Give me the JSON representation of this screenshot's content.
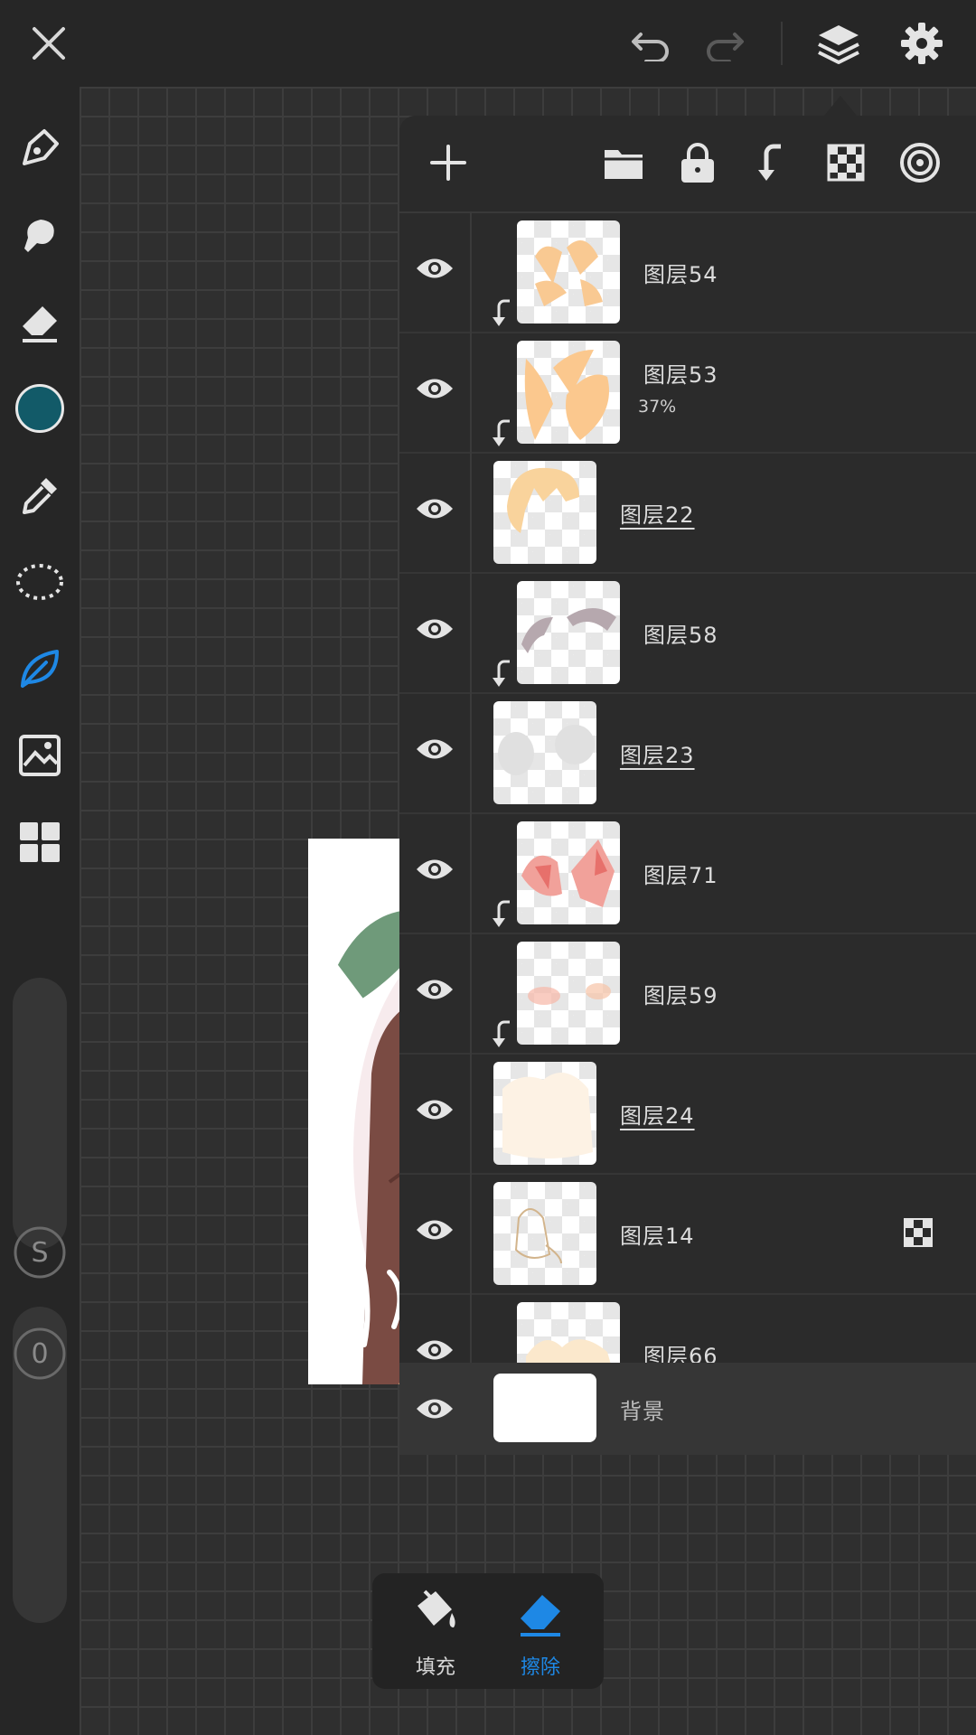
{
  "topbar": {
    "icons": [
      "close-icon",
      "undo-icon",
      "redo-icon",
      "layers-icon",
      "settings-icon"
    ]
  },
  "tools": {
    "icons": [
      "pen-icon",
      "smudge-icon",
      "eraser-icon",
      "color-swatch",
      "eyedropper-icon",
      "lasso-icon",
      "leaf-icon",
      "image-import-icon",
      "grid-icon"
    ],
    "active_color": "#125a68",
    "accent": "#1e88e5",
    "size_knob": "S",
    "opacity_knob": "0"
  },
  "layer_panel": {
    "toolbar_icons": [
      "add-layer-icon",
      "folder-icon",
      "lock-icon",
      "clip-icon",
      "alpha-lock-icon",
      "blend-icon"
    ],
    "layers": [
      {
        "name": "图层54",
        "opacity": "",
        "clipped": true
      },
      {
        "name": "图层53",
        "opacity": "37%",
        "clipped": true
      },
      {
        "name": "图层22",
        "opacity": "",
        "clipped": false
      },
      {
        "name": "图层58",
        "opacity": "",
        "clipped": true
      },
      {
        "name": "图层23",
        "opacity": "",
        "clipped": false
      },
      {
        "name": "图层71",
        "opacity": "",
        "clipped": true
      },
      {
        "name": "图层59",
        "opacity": "",
        "clipped": true
      },
      {
        "name": "图层24",
        "opacity": "",
        "clipped": false
      },
      {
        "name": "图层14",
        "opacity": "",
        "clipped": false
      },
      {
        "name": "图层66",
        "opacity": "",
        "clipped": false
      }
    ],
    "background_label": "背景"
  },
  "bottom_bar": {
    "fill_label": "填充",
    "erase_label": "擦除"
  }
}
